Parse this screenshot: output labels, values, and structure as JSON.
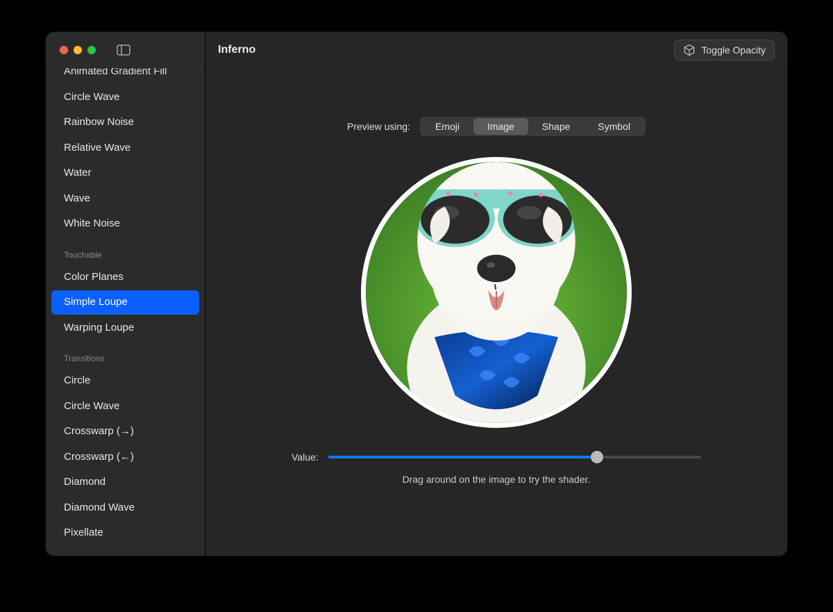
{
  "app": {
    "title": "Inferno"
  },
  "toolbar": {
    "toggle_opacity_label": "Toggle Opacity"
  },
  "sidebar": {
    "partial_top_item": "Animated Gradient Fill",
    "groups": [
      {
        "heading": null,
        "items": [
          {
            "label": "Circle Wave",
            "selected": false
          },
          {
            "label": "Rainbow Noise",
            "selected": false
          },
          {
            "label": "Relative Wave",
            "selected": false
          },
          {
            "label": "Water",
            "selected": false
          },
          {
            "label": "Wave",
            "selected": false
          },
          {
            "label": "White Noise",
            "selected": false
          }
        ]
      },
      {
        "heading": "Touchable",
        "items": [
          {
            "label": "Color Planes",
            "selected": false
          },
          {
            "label": "Simple Loupe",
            "selected": true
          },
          {
            "label": "Warping Loupe",
            "selected": false
          }
        ]
      },
      {
        "heading": "Transitions",
        "items": [
          {
            "label": "Circle",
            "selected": false
          },
          {
            "label": "Circle Wave",
            "selected": false
          },
          {
            "label": "Crosswarp (→)",
            "selected": false
          },
          {
            "label": "Crosswarp (←)",
            "selected": false
          },
          {
            "label": "Diamond",
            "selected": false
          },
          {
            "label": "Diamond Wave",
            "selected": false
          },
          {
            "label": "Pixellate",
            "selected": false
          }
        ]
      }
    ]
  },
  "preview": {
    "label": "Preview using:",
    "options": [
      {
        "label": "Emoji",
        "selected": false
      },
      {
        "label": "Image",
        "selected": true
      },
      {
        "label": "Shape",
        "selected": false
      },
      {
        "label": "Symbol",
        "selected": false
      }
    ],
    "image_description": "dog-with-sunglasses-and-bandana"
  },
  "slider": {
    "label": "Value:",
    "value_percent": 72
  },
  "hint": "Drag around on the image to try the shader."
}
